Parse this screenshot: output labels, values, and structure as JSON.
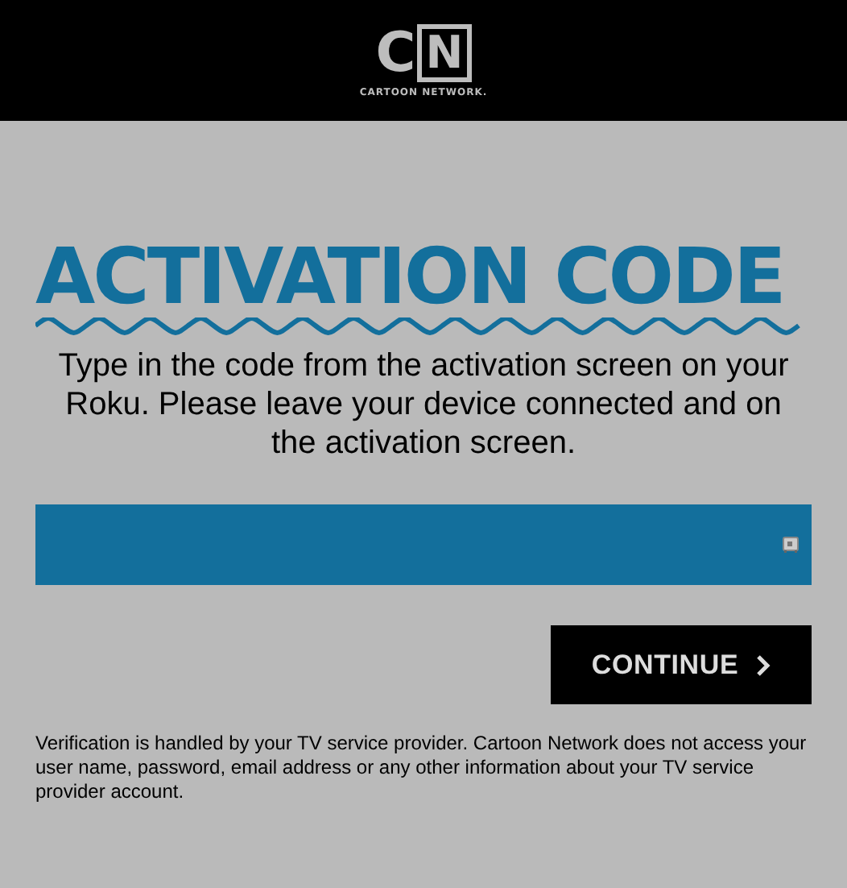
{
  "header": {
    "logo_mark": [
      "C",
      "N"
    ],
    "logo_text": "CARTOON NETWORK."
  },
  "title": "ACTIVATION CODE",
  "instructions": "Type in the code from the activation screen on your Roku. Please leave your device connected and on the activation screen.",
  "continue_button": "CONTINUE",
  "disclaimer": "Verification is handled by your TV service provider. Cartoon Network does not access your user name, password, email address or any other information about your TV service provider account."
}
